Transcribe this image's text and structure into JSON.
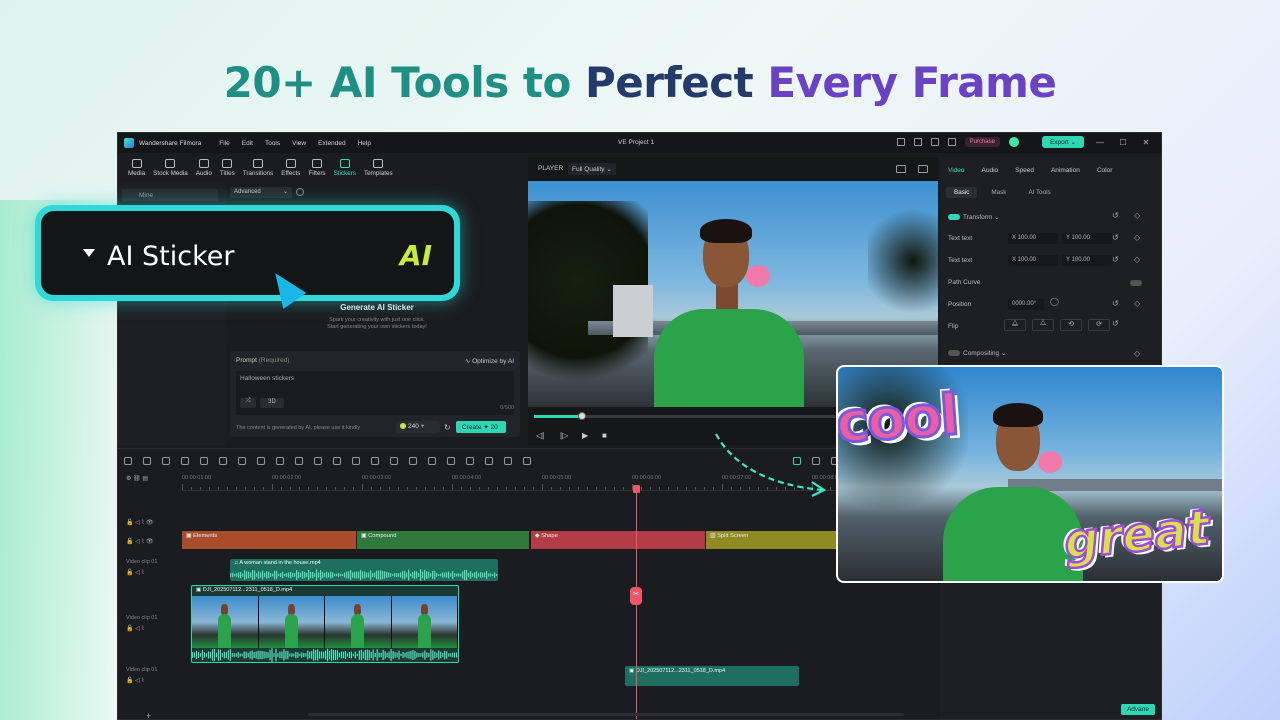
{
  "headline": {
    "part1": "20+ AI Tools to",
    "part2": "Perfect",
    "part3": "Every Frame"
  },
  "app": {
    "name": "Wandershare Filmora",
    "menu": [
      "File",
      "Edit",
      "Tools",
      "View",
      "Extended",
      "Help"
    ],
    "project_title": "VE Project 1",
    "purchase_label": "Purchase",
    "export_label": "Export ⌄"
  },
  "toolbar": {
    "items": [
      {
        "label": "Media",
        "icon": "media-icon"
      },
      {
        "label": "Stock Media",
        "icon": "stock-media-icon"
      },
      {
        "label": "Audio",
        "icon": "audio-icon"
      },
      {
        "label": "Titles",
        "icon": "titles-icon"
      },
      {
        "label": "Transitions",
        "icon": "transitions-icon"
      },
      {
        "label": "Effects",
        "icon": "effects-icon"
      },
      {
        "label": "Filters",
        "icon": "filters-icon"
      },
      {
        "label": "Stickers",
        "icon": "stickers-icon"
      },
      {
        "label": "Templates",
        "icon": "templates-icon"
      }
    ],
    "active": "Stickers"
  },
  "left_panel": {
    "mine_label": "Mine"
  },
  "sticker_panel": {
    "mode_select": "Advanced",
    "generate_title": "Generate AI Sticker",
    "subtitle_line1": "Spark your creativity with just one click.",
    "subtitle_line2": "Start generating your own stickers today!",
    "prompt_label": "Prompt",
    "prompt_required": "(Required)",
    "optimize_label": "Optimize by AI",
    "prompt_value": "Halloween stickers",
    "style_value": "3D",
    "char_count": "0/500",
    "disclaimer": "The content is generated by AI, please use it kindly",
    "credits": "240",
    "create_label": "Create ✦ 20"
  },
  "callout": {
    "label": "AI Sticker",
    "badge": "AI"
  },
  "player": {
    "label": "PLAYER",
    "quality": "Full Quality ⌄",
    "progress": 0.12
  },
  "properties": {
    "tabs": [
      "Video",
      "Audio",
      "Speed",
      "Animation",
      "Color"
    ],
    "active_tab": "Video",
    "subtabs": [
      "Basic",
      "Mask",
      "AI Tools"
    ],
    "active_subtab": "Basic",
    "transform_label": "Transform",
    "row1_label": "Text text",
    "row1_x": "X 100.00",
    "row1_y": "Y 100.00",
    "row2_label": "Text text",
    "row2_x": "X 100.00",
    "row2_y": "Y 100.00",
    "path_curve_label": "Path Curve",
    "position_label": "Position",
    "position_value": "0000.00°",
    "flip_label": "Flip",
    "compositing_label": "Compositing",
    "advanced_label": "Advane"
  },
  "timeline": {
    "ruler": [
      "00:00:01:00",
      "00:00:02:00",
      "00:00:03:00",
      "00:00:04:00",
      "00:00:05:00",
      "00:00:06:00",
      "00:00:07:00",
      "00:00:08:0"
    ],
    "effect_clips": [
      {
        "label": "Elements",
        "color": "#a94c2a"
      },
      {
        "label": "Compound",
        "color": "#2f7a3a"
      },
      {
        "label": "Shape",
        "color": "#b23b45"
      },
      {
        "label": "Split Screen",
        "color": "#8f8a22"
      }
    ],
    "track1_label": "Video clip 01",
    "audio_clip_label": "A woman stand  in the house.mp4",
    "track2_label": "Video clip 01",
    "video_clip_label": "DJI_202507112...2311_0518_D.mp4",
    "track3_label": "Video clip 01",
    "video_clip2_label": "DJI_202507112...2311_0518_D.mp4",
    "cut_icon": "scissors-icon",
    "add_track": "+"
  },
  "result_stickers": {
    "word1": "cool",
    "word2": "great"
  }
}
